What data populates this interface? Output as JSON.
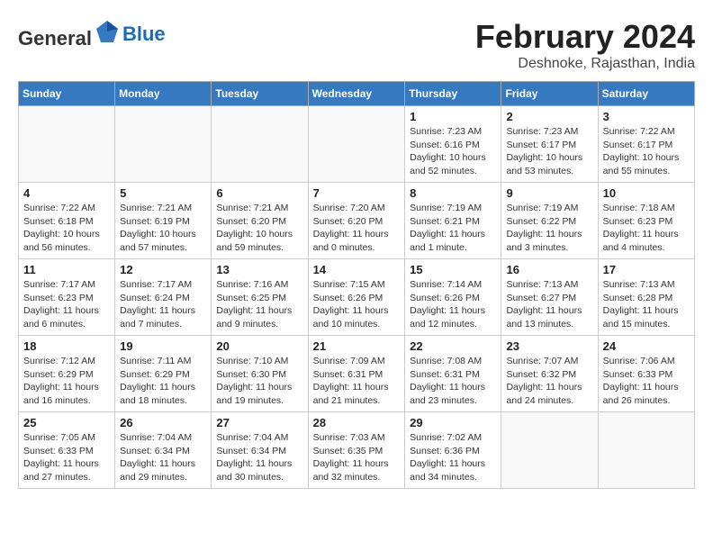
{
  "header": {
    "logo_general": "General",
    "logo_blue": "Blue",
    "month_year": "February 2024",
    "location": "Deshnoke, Rajasthan, India"
  },
  "days_of_week": [
    "Sunday",
    "Monday",
    "Tuesday",
    "Wednesday",
    "Thursday",
    "Friday",
    "Saturday"
  ],
  "weeks": [
    [
      {
        "num": "",
        "info": ""
      },
      {
        "num": "",
        "info": ""
      },
      {
        "num": "",
        "info": ""
      },
      {
        "num": "",
        "info": ""
      },
      {
        "num": "1",
        "info": "Sunrise: 7:23 AM\nSunset: 6:16 PM\nDaylight: 10 hours and 52 minutes."
      },
      {
        "num": "2",
        "info": "Sunrise: 7:23 AM\nSunset: 6:17 PM\nDaylight: 10 hours and 53 minutes."
      },
      {
        "num": "3",
        "info": "Sunrise: 7:22 AM\nSunset: 6:17 PM\nDaylight: 10 hours and 55 minutes."
      }
    ],
    [
      {
        "num": "4",
        "info": "Sunrise: 7:22 AM\nSunset: 6:18 PM\nDaylight: 10 hours and 56 minutes."
      },
      {
        "num": "5",
        "info": "Sunrise: 7:21 AM\nSunset: 6:19 PM\nDaylight: 10 hours and 57 minutes."
      },
      {
        "num": "6",
        "info": "Sunrise: 7:21 AM\nSunset: 6:20 PM\nDaylight: 10 hours and 59 minutes."
      },
      {
        "num": "7",
        "info": "Sunrise: 7:20 AM\nSunset: 6:20 PM\nDaylight: 11 hours and 0 minutes."
      },
      {
        "num": "8",
        "info": "Sunrise: 7:19 AM\nSunset: 6:21 PM\nDaylight: 11 hours and 1 minute."
      },
      {
        "num": "9",
        "info": "Sunrise: 7:19 AM\nSunset: 6:22 PM\nDaylight: 11 hours and 3 minutes."
      },
      {
        "num": "10",
        "info": "Sunrise: 7:18 AM\nSunset: 6:23 PM\nDaylight: 11 hours and 4 minutes."
      }
    ],
    [
      {
        "num": "11",
        "info": "Sunrise: 7:17 AM\nSunset: 6:23 PM\nDaylight: 11 hours and 6 minutes."
      },
      {
        "num": "12",
        "info": "Sunrise: 7:17 AM\nSunset: 6:24 PM\nDaylight: 11 hours and 7 minutes."
      },
      {
        "num": "13",
        "info": "Sunrise: 7:16 AM\nSunset: 6:25 PM\nDaylight: 11 hours and 9 minutes."
      },
      {
        "num": "14",
        "info": "Sunrise: 7:15 AM\nSunset: 6:26 PM\nDaylight: 11 hours and 10 minutes."
      },
      {
        "num": "15",
        "info": "Sunrise: 7:14 AM\nSunset: 6:26 PM\nDaylight: 11 hours and 12 minutes."
      },
      {
        "num": "16",
        "info": "Sunrise: 7:13 AM\nSunset: 6:27 PM\nDaylight: 11 hours and 13 minutes."
      },
      {
        "num": "17",
        "info": "Sunrise: 7:13 AM\nSunset: 6:28 PM\nDaylight: 11 hours and 15 minutes."
      }
    ],
    [
      {
        "num": "18",
        "info": "Sunrise: 7:12 AM\nSunset: 6:29 PM\nDaylight: 11 hours and 16 minutes."
      },
      {
        "num": "19",
        "info": "Sunrise: 7:11 AM\nSunset: 6:29 PM\nDaylight: 11 hours and 18 minutes."
      },
      {
        "num": "20",
        "info": "Sunrise: 7:10 AM\nSunset: 6:30 PM\nDaylight: 11 hours and 19 minutes."
      },
      {
        "num": "21",
        "info": "Sunrise: 7:09 AM\nSunset: 6:31 PM\nDaylight: 11 hours and 21 minutes."
      },
      {
        "num": "22",
        "info": "Sunrise: 7:08 AM\nSunset: 6:31 PM\nDaylight: 11 hours and 23 minutes."
      },
      {
        "num": "23",
        "info": "Sunrise: 7:07 AM\nSunset: 6:32 PM\nDaylight: 11 hours and 24 minutes."
      },
      {
        "num": "24",
        "info": "Sunrise: 7:06 AM\nSunset: 6:33 PM\nDaylight: 11 hours and 26 minutes."
      }
    ],
    [
      {
        "num": "25",
        "info": "Sunrise: 7:05 AM\nSunset: 6:33 PM\nDaylight: 11 hours and 27 minutes."
      },
      {
        "num": "26",
        "info": "Sunrise: 7:04 AM\nSunset: 6:34 PM\nDaylight: 11 hours and 29 minutes."
      },
      {
        "num": "27",
        "info": "Sunrise: 7:04 AM\nSunset: 6:34 PM\nDaylight: 11 hours and 30 minutes."
      },
      {
        "num": "28",
        "info": "Sunrise: 7:03 AM\nSunset: 6:35 PM\nDaylight: 11 hours and 32 minutes."
      },
      {
        "num": "29",
        "info": "Sunrise: 7:02 AM\nSunset: 6:36 PM\nDaylight: 11 hours and 34 minutes."
      },
      {
        "num": "",
        "info": ""
      },
      {
        "num": "",
        "info": ""
      }
    ]
  ]
}
